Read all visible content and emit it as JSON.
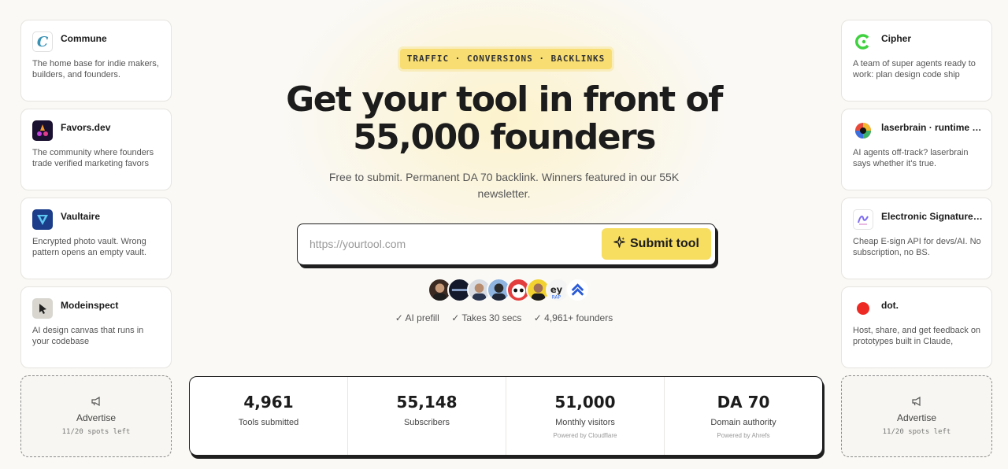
{
  "left_tools": [
    {
      "name": "Commune",
      "desc": "The home base for indie makers, builders, and founders.",
      "icon": "commune-logo-icon"
    },
    {
      "name": "Favors.dev",
      "desc": "The community where founders trade verified marketing favors",
      "icon": "favors-logo-icon"
    },
    {
      "name": "Vaultaire",
      "desc": "Encrypted photo vault. Wrong pattern opens an empty vault.",
      "icon": "vaultaire-logo-icon"
    },
    {
      "name": "Modeinspect",
      "desc": "AI design canvas that runs in your codebase",
      "icon": "modeinspect-logo-icon"
    }
  ],
  "right_tools": [
    {
      "name": "Cipher",
      "desc": "A team of super agents ready to work: plan design code ship",
      "icon": "cipher-logo-icon"
    },
    {
      "name": "laserbrain · runtime g...",
      "desc": "AI agents off-track? laserbrain says whether it's true.",
      "icon": "laserbrain-logo-icon"
    },
    {
      "name": "Electronic Signature ...",
      "desc": "Cheap E-sign API for devs/AI. No subscription, no BS.",
      "icon": "esignature-logo-icon"
    },
    {
      "name": "dot.",
      "desc": "Host, share, and get feedback on prototypes built in Claude,",
      "icon": "dot-logo-icon"
    }
  ],
  "advertise": {
    "label": "Advertise",
    "spots": "11/20 spots left",
    "icon": "megaphone-icon"
  },
  "hero": {
    "badge": "TRAFFIC · CONVERSIONS · BACKLINKS",
    "headline_line1": "Get your tool in front of",
    "headline_line2": "55,000 founders",
    "subtext": "Free to submit. Permanent DA 70 backlink. Winners featured in our 55K newsletter."
  },
  "submit_form": {
    "placeholder": "https://yourtool.com",
    "value": "",
    "button_label": "Submit tool",
    "button_icon": "sparkle-icon"
  },
  "checks": [
    "✓ AI prefill",
    "✓ Takes 30 secs",
    "✓ 4,961+ founders"
  ],
  "stats": [
    {
      "value": "4,961",
      "label": "Tools submitted",
      "source": ""
    },
    {
      "value": "55,148",
      "label": "Subscribers",
      "source": ""
    },
    {
      "value": "51,000",
      "label": "Monthly visitors",
      "source": "Powered by Cloudflare"
    },
    {
      "value": "DA 70",
      "label": "Domain authority",
      "source": "Powered by Ahrefs"
    }
  ],
  "colors": {
    "accent_yellow": "#f7dd60",
    "text": "#1c1c1c",
    "background": "#faf9f6"
  }
}
